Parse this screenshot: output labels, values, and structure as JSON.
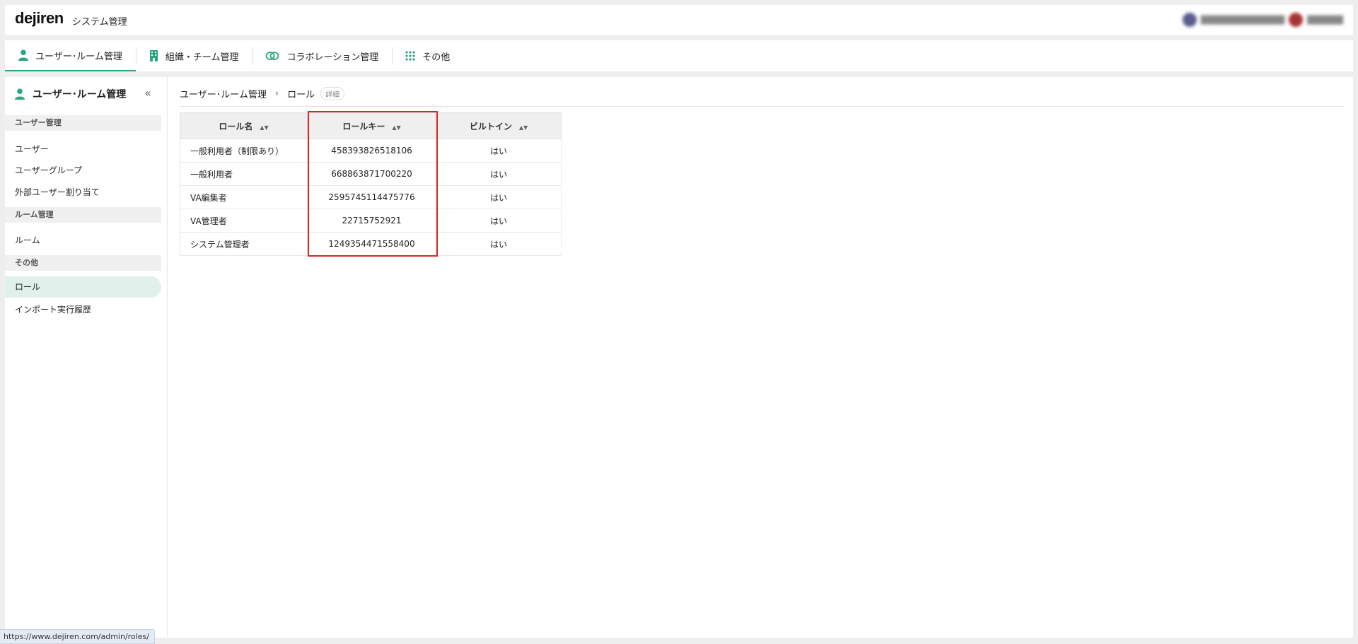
{
  "header": {
    "logo": "dejiren",
    "title": "システム管理"
  },
  "tabs": [
    {
      "label": "ユーザー･ルーム管理",
      "icon": "user-icon",
      "active": true
    },
    {
      "label": "組織・チーム管理",
      "icon": "building-icon",
      "active": false
    },
    {
      "label": "コラボレーション管理",
      "icon": "link-icon",
      "active": false
    },
    {
      "label": "その他",
      "icon": "grid-icon",
      "active": false
    }
  ],
  "sidebar": {
    "title": "ユーザー･ルーム管理",
    "collapse": "«",
    "sections": [
      {
        "label": "ユーザー管理",
        "items": [
          "ユーザー",
          "ユーザーグループ",
          "外部ユーザー割り当て"
        ]
      },
      {
        "label": "ルーム管理",
        "items": [
          "ルーム"
        ]
      },
      {
        "label": "その他",
        "items": [
          "ロール",
          "インポート実行履歴"
        ]
      }
    ],
    "active_item": "ロール"
  },
  "breadcrumb": {
    "root": "ユーザー･ルーム管理",
    "sep": "›",
    "current": "ロール",
    "badge": "詳細"
  },
  "table": {
    "headers": [
      "ロール名",
      "ロールキー",
      "ビルトイン"
    ],
    "sort_glyph": "▲▼",
    "rows": [
      [
        "一般利用者（制限あり）",
        "458393826518106",
        "はい"
      ],
      [
        "一般利用者",
        "668863871700220",
        "はい"
      ],
      [
        "VA編集者",
        "2595745114475776",
        "はい"
      ],
      [
        "VA管理者",
        "22715752921",
        "はい"
      ],
      [
        "システム管理者",
        "1249354471558400",
        "はい"
      ]
    ]
  },
  "status_url": "https://www.dejiren.com/admin/roles/",
  "colors": {
    "accent": "#2ba57e",
    "highlight": "#e02424"
  }
}
